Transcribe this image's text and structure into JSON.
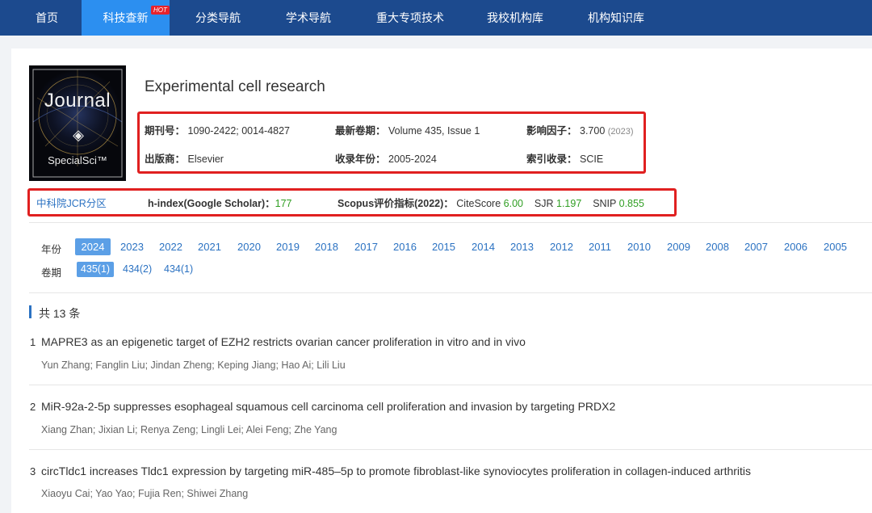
{
  "nav": {
    "items": [
      "首页",
      "科技查新",
      "分类导航",
      "学术导航",
      "重大专项技术",
      "我校机构库",
      "机构知识库"
    ],
    "hot_badge": "HOT"
  },
  "cover": {
    "title": "Journal",
    "brand": "SpecialSci™",
    "logo_icon": "stacked-layers-icon"
  },
  "journal": {
    "title": "Experimental cell research",
    "issn_label": "期刊号：",
    "issn_value": "1090-2422; 0014-4827",
    "latest_label": "最新卷期：",
    "latest_value": "Volume 435, Issue 1",
    "if_label": "影响因子：",
    "if_value": "3.700",
    "if_year": "(2023)",
    "publisher_label": "出版商：",
    "publisher_value": "Elsevier",
    "years_label": "收录年份：",
    "years_value": "2005-2024",
    "index_label": "索引收录：",
    "index_value": "SCIE"
  },
  "metrics": {
    "jcr_link": "中科院JCR分区",
    "hindex_label": "h-index(Google Scholar)：",
    "hindex_value": "177",
    "scopus_label": "Scopus评价指标(2022)：",
    "citescore_label": "CiteScore",
    "citescore_value": "6.00",
    "sjr_label": "SJR",
    "sjr_value": "1.197",
    "snip_label": "SNIP",
    "snip_value": "0.855"
  },
  "filters": {
    "year_label": "年份",
    "years": [
      "2024",
      "2023",
      "2022",
      "2021",
      "2020",
      "2019",
      "2018",
      "2017",
      "2016",
      "2015",
      "2014",
      "2013",
      "2012",
      "2011",
      "2010",
      "2009",
      "2008",
      "2007",
      "2006",
      "2005"
    ],
    "selected_year": "2024",
    "volume_label": "卷期",
    "volumes": [
      "435(1)",
      "434(2)",
      "434(1)"
    ],
    "selected_volume": "435(1)"
  },
  "results": {
    "count_text": "共 13 条"
  },
  "articles": [
    {
      "num": "1",
      "title": "MAPRE3 as an epigenetic target of EZH2 restricts ovarian cancer proliferation in vitro and in vivo",
      "authors": "Yun Zhang; Fanglin Liu; Jindan Zheng; Keping Jiang; Hao Ai; Lili Liu"
    },
    {
      "num": "2",
      "title": "MiR-92a-2-5p suppresses esophageal squamous cell carcinoma cell proliferation and invasion by targeting PRDX2",
      "authors": "Xiang Zhan; Jixian Li; Renya Zeng; Lingli Lei; Alei Feng; Zhe Yang"
    },
    {
      "num": "3",
      "title": "circTldc1 increases Tldc1 expression by targeting miR-485–5p to promote fibroblast-like synoviocytes proliferation in collagen-induced arthritis",
      "authors": "Xiaoyu Cai; Yao Yao; Fujia Ren; Shiwei Zhang"
    }
  ],
  "colors": {
    "nav_bg": "#1c4a8e",
    "nav_active": "#2c8ff0",
    "link": "#2b72c2",
    "highlight_box": "#e02020",
    "metric_green": "#2f9e22"
  }
}
